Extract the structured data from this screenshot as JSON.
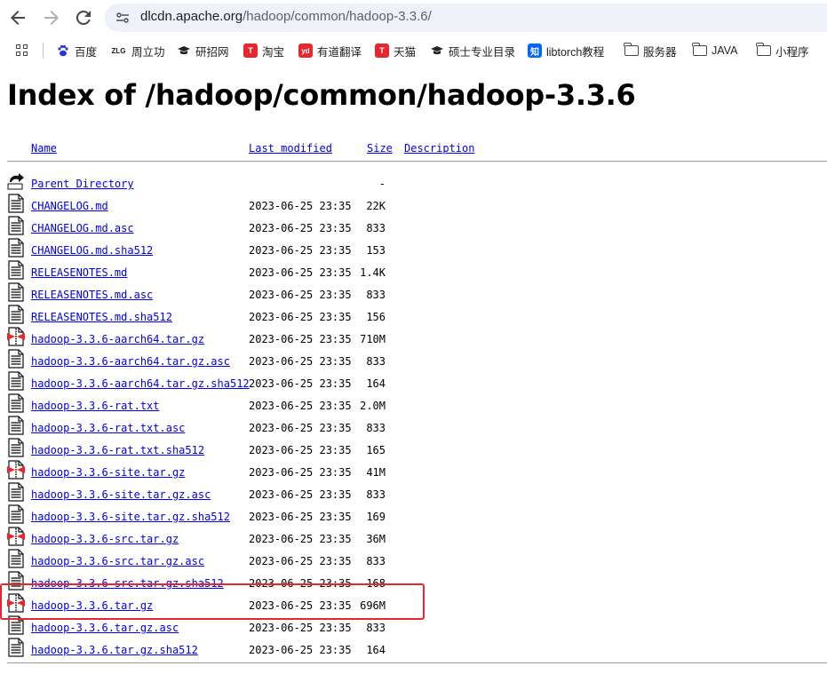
{
  "browser": {
    "url_host": "dlcdn.apache.org",
    "url_path": "/hadoop/common/hadoop-3.3.6/"
  },
  "bookmarks": [
    {
      "label": "百度",
      "icon": "baidu-paw-icon",
      "color": "#2932e1"
    },
    {
      "label": "周立功",
      "icon": "zlg-icon",
      "color": "#1a1a1a"
    },
    {
      "label": "研招网",
      "icon": "graduation-cap-icon",
      "color": "#1a1a1a"
    },
    {
      "label": "淘宝",
      "icon": "taobao-t-icon",
      "color": "#e8262b"
    },
    {
      "label": "有道翻译",
      "icon": "youdao-icon",
      "color": "#e8262b"
    },
    {
      "label": "天猫",
      "icon": "tmall-t-icon",
      "color": "#e8262b"
    },
    {
      "label": "硕士专业目录",
      "icon": "graduation-cap-icon",
      "color": "#1a1a1a"
    },
    {
      "label": "libtorch教程",
      "icon": "zhihu-icon",
      "color": "#0066ff"
    },
    {
      "label": "服务器",
      "icon": "folder-icon"
    },
    {
      "label": "JAVA",
      "icon": "folder-icon"
    },
    {
      "label": "小程序",
      "icon": "folder-icon"
    }
  ],
  "page": {
    "title": "Index of /hadoop/common/hadoop-3.3.6",
    "columns": {
      "name": "Name",
      "last_modified": "Last modified",
      "size": "Size",
      "description": "Description"
    },
    "parent": {
      "name": "Parent Directory",
      "size": "-"
    },
    "files": [
      {
        "name": "CHANGELOG.md",
        "date": "2023-06-25 23:35",
        "size": "22K",
        "type": "text"
      },
      {
        "name": "CHANGELOG.md.asc",
        "date": "2023-06-25 23:35",
        "size": "833",
        "type": "text"
      },
      {
        "name": "CHANGELOG.md.sha512",
        "date": "2023-06-25 23:35",
        "size": "153",
        "type": "text"
      },
      {
        "name": "RELEASENOTES.md",
        "date": "2023-06-25 23:35",
        "size": "1.4K",
        "type": "text"
      },
      {
        "name": "RELEASENOTES.md.asc",
        "date": "2023-06-25 23:35",
        "size": "833",
        "type": "text"
      },
      {
        "name": "RELEASENOTES.md.sha512",
        "date": "2023-06-25 23:35",
        "size": "156",
        "type": "text"
      },
      {
        "name": "hadoop-3.3.6-aarch64.tar.gz",
        "date": "2023-06-25 23:35",
        "size": "710M",
        "type": "archive"
      },
      {
        "name": "hadoop-3.3.6-aarch64.tar.gz.asc",
        "date": "2023-06-25 23:35",
        "size": "833",
        "type": "text"
      },
      {
        "name": "hadoop-3.3.6-aarch64.tar.gz.sha512",
        "date": "2023-06-25 23:35",
        "size": "164",
        "type": "text"
      },
      {
        "name": "hadoop-3.3.6-rat.txt",
        "date": "2023-06-25 23:35",
        "size": "2.0M",
        "type": "text"
      },
      {
        "name": "hadoop-3.3.6-rat.txt.asc",
        "date": "2023-06-25 23:35",
        "size": "833",
        "type": "text"
      },
      {
        "name": "hadoop-3.3.6-rat.txt.sha512",
        "date": "2023-06-25 23:35",
        "size": "165",
        "type": "text"
      },
      {
        "name": "hadoop-3.3.6-site.tar.gz",
        "date": "2023-06-25 23:35",
        "size": "41M",
        "type": "archive"
      },
      {
        "name": "hadoop-3.3.6-site.tar.gz.asc",
        "date": "2023-06-25 23:35",
        "size": "833",
        "type": "text"
      },
      {
        "name": "hadoop-3.3.6-site.tar.gz.sha512",
        "date": "2023-06-25 23:35",
        "size": "169",
        "type": "text"
      },
      {
        "name": "hadoop-3.3.6-src.tar.gz",
        "date": "2023-06-25 23:35",
        "size": "36M",
        "type": "archive"
      },
      {
        "name": "hadoop-3.3.6-src.tar.gz.asc",
        "date": "2023-06-25 23:35",
        "size": "833",
        "type": "text"
      },
      {
        "name": "hadoop-3.3.6-src.tar.gz.sha512",
        "date": "2023-06-25 23:35",
        "size": "168",
        "type": "text"
      },
      {
        "name": "hadoop-3.3.6.tar.gz",
        "date": "2023-06-25 23:35",
        "size": "696M",
        "type": "archive",
        "highlighted": true
      },
      {
        "name": "hadoop-3.3.6.tar.gz.asc",
        "date": "2023-06-25 23:35",
        "size": "833",
        "type": "text"
      },
      {
        "name": "hadoop-3.3.6.tar.gz.sha512",
        "date": "2023-06-25 23:35",
        "size": "164",
        "type": "text"
      }
    ]
  },
  "colors": {
    "link": "#0000ee",
    "highlight": "#e8262b"
  }
}
